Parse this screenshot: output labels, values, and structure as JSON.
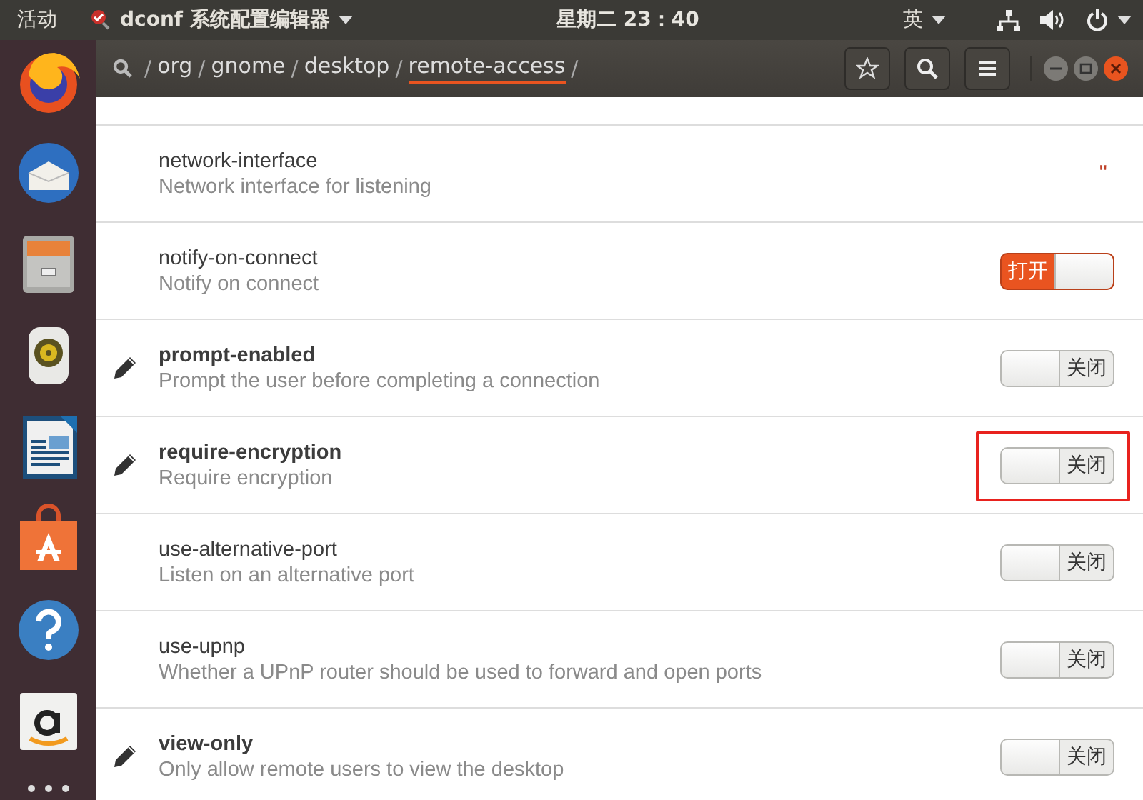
{
  "top_bar": {
    "activities": "活动",
    "app_menu": "dconf 系统配置编辑器",
    "clock": "星期二 23：40",
    "input_method": "英"
  },
  "path_bar": {
    "items": [
      {
        "kind": "separator",
        "text": "/"
      },
      {
        "kind": "segment",
        "text": "org",
        "selected": false
      },
      {
        "kind": "separator",
        "text": "/"
      },
      {
        "kind": "segment",
        "text": "gnome",
        "selected": false
      },
      {
        "kind": "separator",
        "text": "/"
      },
      {
        "kind": "segment",
        "text": "desktop",
        "selected": false
      },
      {
        "kind": "separator",
        "text": "/"
      },
      {
        "kind": "segment",
        "text": "remote-access",
        "selected": true
      },
      {
        "kind": "separator",
        "text": "/"
      }
    ]
  },
  "rows": [
    {
      "kind": "string",
      "name": "network-interface",
      "description": "Network interface for listening",
      "value": "''",
      "modified": false,
      "highlighted": false
    },
    {
      "kind": "switch",
      "name": "notify-on-connect",
      "description": "Notify on connect",
      "on": true,
      "state_label": "打开",
      "modified": false,
      "highlighted": false
    },
    {
      "kind": "switch",
      "name": "prompt-enabled",
      "description": "Prompt the user before completing a connection",
      "on": false,
      "state_label": "关闭",
      "modified": true,
      "highlighted": false
    },
    {
      "kind": "switch",
      "name": "require-encryption",
      "description": "Require encryption",
      "on": false,
      "state_label": "关闭",
      "modified": true,
      "highlighted": true
    },
    {
      "kind": "switch",
      "name": "use-alternative-port",
      "description": "Listen on an alternative port",
      "on": false,
      "state_label": "关闭",
      "modified": false,
      "highlighted": false
    },
    {
      "kind": "switch",
      "name": "use-upnp",
      "description": "Whether a UPnP router should be used to forward and open ports",
      "on": false,
      "state_label": "关闭",
      "modified": false,
      "highlighted": false
    },
    {
      "kind": "switch",
      "name": "view-only",
      "description": "Only allow remote users to view the desktop",
      "on": false,
      "state_label": "关闭",
      "modified": true,
      "highlighted": false
    }
  ]
}
